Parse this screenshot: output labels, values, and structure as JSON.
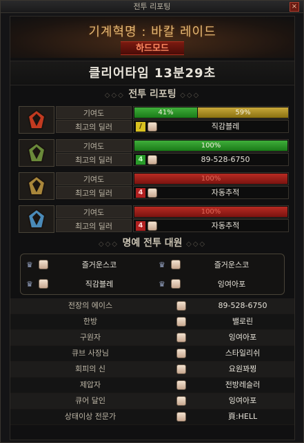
{
  "window": {
    "title": "전투 리포팅",
    "close_label": "×"
  },
  "header": {
    "raid_title": "기계혁명 : 바칼 레이드",
    "mode": "하드모드"
  },
  "clear_time": "클리어타임 13분29초",
  "sections": {
    "report": "전투 리포팅",
    "honor": "명예 전투 대원"
  },
  "labels": {
    "contribution": "기여도",
    "best_dealer": "최고의 딜러"
  },
  "parties": [
    {
      "portrait": "red-dragon-portrait",
      "segments": [
        {
          "label": "41%",
          "value": 41,
          "color": "green"
        },
        {
          "label": "59%",
          "value": 59,
          "color": "gold"
        }
      ],
      "dealer_job": "/",
      "dealer_job_color": "yellow",
      "dealer": "직감블레"
    },
    {
      "portrait": "green-dragon-portrait",
      "segments": [
        {
          "label": "100%",
          "value": 100,
          "color": "green"
        }
      ],
      "dealer_job": "4",
      "dealer_job_color": "green",
      "dealer": "89-528-6750"
    },
    {
      "portrait": "gold-dragon-portrait",
      "segments": [
        {
          "label": "100%",
          "value": 100,
          "color": "red"
        }
      ],
      "dealer_job": "4",
      "dealer_job_color": "red",
      "dealer": "자동추적"
    },
    {
      "portrait": "ice-dragon-portrait",
      "segments": [
        {
          "label": "100%",
          "value": 100,
          "color": "red"
        }
      ],
      "dealer_job": "4",
      "dealer_job_color": "red",
      "dealer": "자동추적"
    }
  ],
  "honor": [
    "즐거운스코",
    "즐거운스코",
    "직감블레",
    "잉여아포"
  ],
  "awards": [
    {
      "award": "전장의 에이스",
      "player": "89-528-6750"
    },
    {
      "award": "한방",
      "player": "밸로린"
    },
    {
      "award": "구원자",
      "player": "잉여아포"
    },
    {
      "award": "큐브 사장님",
      "player": "스타일리쉬"
    },
    {
      "award": "회피의 신",
      "player": "요원꽈찡"
    },
    {
      "award": "제압자",
      "player": "전방레슬러"
    },
    {
      "award": "큐어 달인",
      "player": "잉여아포"
    },
    {
      "award": "상태이상 전문가",
      "player": "頁:HELL"
    }
  ],
  "colors": {
    "accent": "#e6b873",
    "mode_red": "#ff8a60",
    "bar_green": "#1a7a18",
    "bar_gold": "#8a7010",
    "bar_red": "#7a1410"
  }
}
